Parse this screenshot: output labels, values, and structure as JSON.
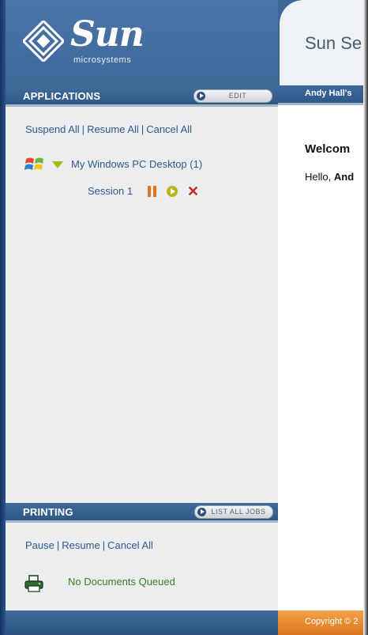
{
  "logo": {
    "brand": "Sun",
    "sub": "microsystems"
  },
  "applications": {
    "title": "APPLICATIONS",
    "edit_label": "EDIT",
    "actions": [
      "Suspend All",
      "Resume All",
      "Cancel All"
    ],
    "desktop": {
      "label": "My Windows PC Desktop (1)",
      "icon": "windows-logo-icon"
    },
    "session": {
      "label": "Session 1",
      "pause_icon": "pause-icon",
      "resume_icon": "resume-icon",
      "cancel_icon": "cancel-icon"
    }
  },
  "printing": {
    "title": "PRINTING",
    "list_jobs_label": "LIST ALL JOBS",
    "actions": [
      "Pause",
      "Resume",
      "Cancel All"
    ],
    "status": "No Documents Queued",
    "status_icon": "printer-icon"
  },
  "main": {
    "title": "Sun Se",
    "user_bar": "Andy Hall's",
    "welcome": "Welcom",
    "hello_prefix": "Hello, ",
    "hello_name": "And",
    "copyright": "Copyright © 2"
  },
  "colors": {
    "header_blue": "#2f5886",
    "link_blue": "#2f5b8f",
    "pause_orange": "#e0761c",
    "resume_yellow": "#b7b616",
    "cancel_red": "#c0281f",
    "status_green": "#3d7b25",
    "copyright_orange": "#d9761d"
  }
}
